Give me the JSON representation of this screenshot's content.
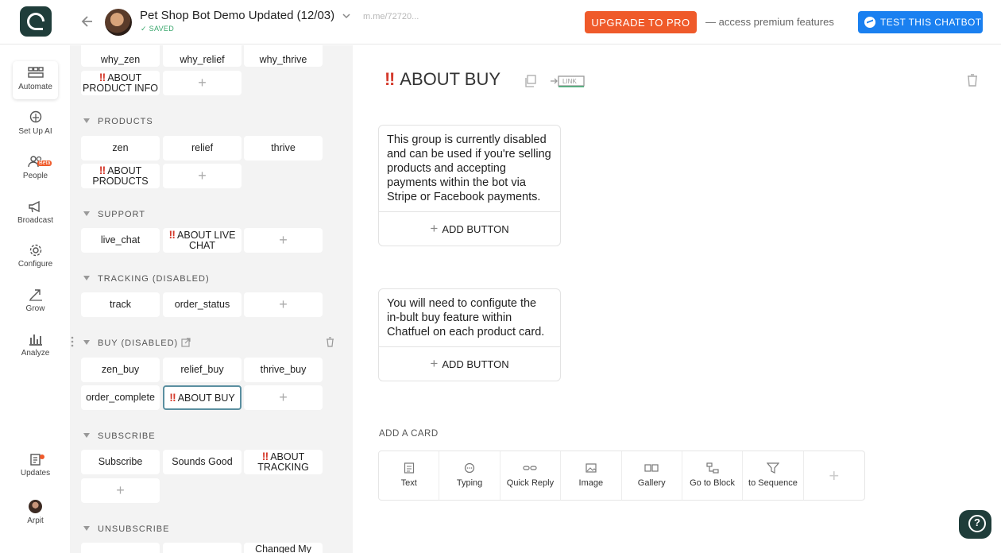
{
  "header": {
    "bot_title": "Pet Shop Bot Demo Updated (12/03)",
    "saved": "SAVED",
    "bot_link": "m.me/72720...",
    "upgrade_label": "UPGRADE TO PRO",
    "premium_text": "— access premium features",
    "test_label": "TEST THIS CHATBOT"
  },
  "nav": {
    "automate": "Automate",
    "setup_ai": "Set Up AI",
    "people": "People",
    "beta": "Beta",
    "broadcast": "Broadcast",
    "configure": "Configure",
    "grow": "Grow",
    "analyze": "Analyze",
    "updates": "Updates",
    "user": "Arpit"
  },
  "blocks": {
    "top_row": [
      "why_zen",
      "why_relief",
      "why_thrive"
    ],
    "about_product_info": "ABOUT PRODUCT INFO",
    "products_label": "PRODUCTS",
    "products": [
      "zen",
      "relief",
      "thrive"
    ],
    "about_products": "ABOUT PRODUCTS",
    "support_label": "SUPPORT",
    "live_chat": "live_chat",
    "about_live_chat": "ABOUT LIVE CHAT",
    "tracking_label": "TRACKING (DISABLED)",
    "track": "track",
    "order_status": "order_status",
    "buy_label": "BUY (DISABLED)",
    "buy": [
      "zen_buy",
      "relief_buy",
      "thrive_buy"
    ],
    "order_complete": "order_complete",
    "about_buy": "ABOUT BUY",
    "subscribe_label": "SUBSCRIBE",
    "subscribe": "Subscribe",
    "sounds_good": "Sounds Good",
    "about_tracking": "ABOUT TRACKING",
    "unsubscribe_label": "UNSUBSCRIBE",
    "changed_my": "Changed My"
  },
  "editor": {
    "block_title": "ABOUT BUY",
    "link_label": "LINK",
    "card1_text": "This group is currently disabled and can be used if you're selling products and accepting payments within the bot via Stripe or Facebook payments.",
    "card2_text": "You will need to configute the in-bult buy feature within Chatfuel on each product card.",
    "add_button": "ADD BUTTON",
    "add_card_label": "ADD A CARD",
    "tools": [
      "Text",
      "Typing",
      "Quick Reply",
      "Image",
      "Gallery",
      "Go to Block",
      "to Sequence"
    ]
  },
  "colors": {
    "upgrade": "#ef5a2a",
    "test": "#1a80f0",
    "logo": "#1f3d3a",
    "alert_mark": "#d43a2c"
  }
}
